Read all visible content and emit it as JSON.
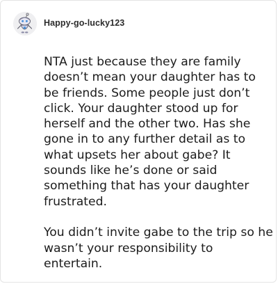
{
  "post": {
    "username": "Happy-go-lucky123",
    "avatar_icon": "snoo-avatar-icon",
    "paragraphs": [
      "NTA just because they are family doesn’t mean your daughter has to be friends. Some people just don’t click. Your daughter stood up for herself and the other two. Has she gone in to any further detail as to what upsets her about gabe? It sounds like he’s done or said something that has your daughter frustrated.",
      "You didn’t invite gabe to the trip so he wasn’t your responsibility to entertain."
    ]
  },
  "colors": {
    "card_border": "#e4e4e4",
    "avatar_bg": "#efeff1",
    "text": "#1c1c1c",
    "accent_blue": "#4a90d9"
  }
}
